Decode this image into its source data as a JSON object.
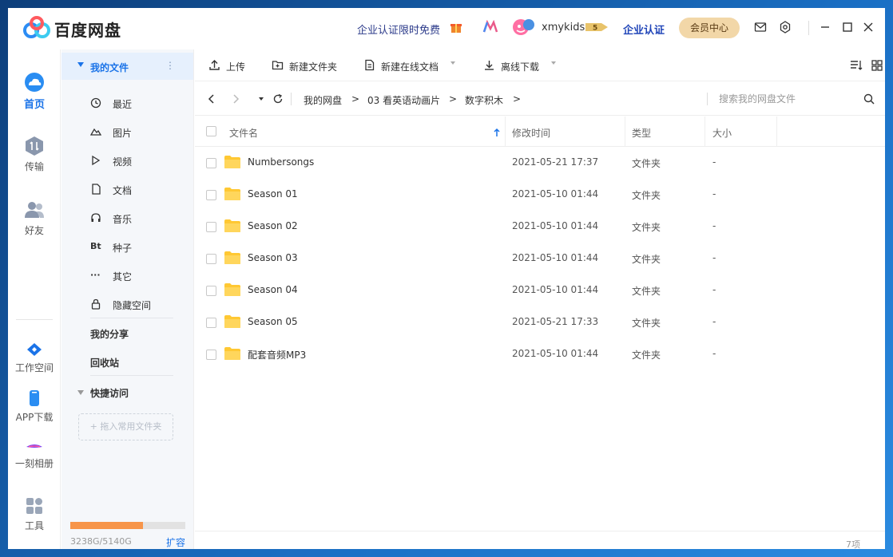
{
  "app": {
    "title": "百度网盘",
    "promo": "企业认证限时免费",
    "username": "xmykids",
    "vip_level": "5",
    "certify": "企业认证",
    "member_center": "会员中心"
  },
  "rail": {
    "items": [
      {
        "label": "首页",
        "icon": "cloud-icon",
        "active": true
      },
      {
        "label": "传输",
        "icon": "transfer-icon"
      },
      {
        "label": "好友",
        "icon": "friends-icon"
      },
      {
        "label": "工作空间",
        "icon": "workspace-icon"
      },
      {
        "label": "APP下载",
        "icon": "phone-icon"
      },
      {
        "label": "一刻相册",
        "icon": "album-icon"
      },
      {
        "label": "工具",
        "icon": "tools-icon"
      }
    ]
  },
  "tree": {
    "my_files": "我的文件",
    "items": [
      {
        "label": "最近",
        "icon": "clock-icon"
      },
      {
        "label": "图片",
        "icon": "image-icon"
      },
      {
        "label": "视频",
        "icon": "play-icon"
      },
      {
        "label": "文档",
        "icon": "document-icon"
      },
      {
        "label": "音乐",
        "icon": "headphones-icon"
      },
      {
        "label": "种子",
        "icon": "bt-icon",
        "glyph": "Bt"
      },
      {
        "label": "其它",
        "icon": "more-icon",
        "glyph": "···"
      },
      {
        "label": "隐藏空间",
        "icon": "lock-icon"
      }
    ],
    "my_share": "我的分享",
    "recycle": "回收站",
    "quick_access": "快捷访问",
    "drop_hint": "+ 拖入常用文件夹"
  },
  "storage": {
    "used": "3238G",
    "total": "5140G",
    "text": "3238G/5140G",
    "fraction": 0.63,
    "expand": "扩容"
  },
  "toolbar": {
    "upload": "上传",
    "new_folder": "新建文件夹",
    "new_doc": "新建在线文档",
    "offline": "离线下载"
  },
  "path": {
    "crumbs": [
      "我的网盘",
      "03 看英语动画片",
      "数字积木"
    ],
    "separator": ">",
    "search_placeholder": "搜索我的网盘文件"
  },
  "table": {
    "headers": {
      "name": "文件名",
      "modified": "修改时间",
      "type": "类型",
      "size": "大小"
    },
    "rows": [
      {
        "name": "Numbersongs",
        "modified": "2021-05-21 17:37",
        "type": "文件夹",
        "size": "-"
      },
      {
        "name": "Season 01",
        "modified": "2021-05-10 01:44",
        "type": "文件夹",
        "size": "-"
      },
      {
        "name": "Season 02",
        "modified": "2021-05-10 01:44",
        "type": "文件夹",
        "size": "-"
      },
      {
        "name": "Season 03",
        "modified": "2021-05-10 01:44",
        "type": "文件夹",
        "size": "-"
      },
      {
        "name": "Season 04",
        "modified": "2021-05-10 01:44",
        "type": "文件夹",
        "size": "-"
      },
      {
        "name": "Season 05",
        "modified": "2021-05-21 17:33",
        "type": "文件夹",
        "size": "-"
      },
      {
        "name": "配套音频MP3",
        "modified": "2021-05-10 01:44",
        "type": "文件夹",
        "size": "-"
      }
    ]
  },
  "status": {
    "count": "7项"
  },
  "colors": {
    "accent": "#1a73e8",
    "folder": "#ffc833",
    "storage": "#f7954a",
    "member": "#f2d7a8"
  }
}
